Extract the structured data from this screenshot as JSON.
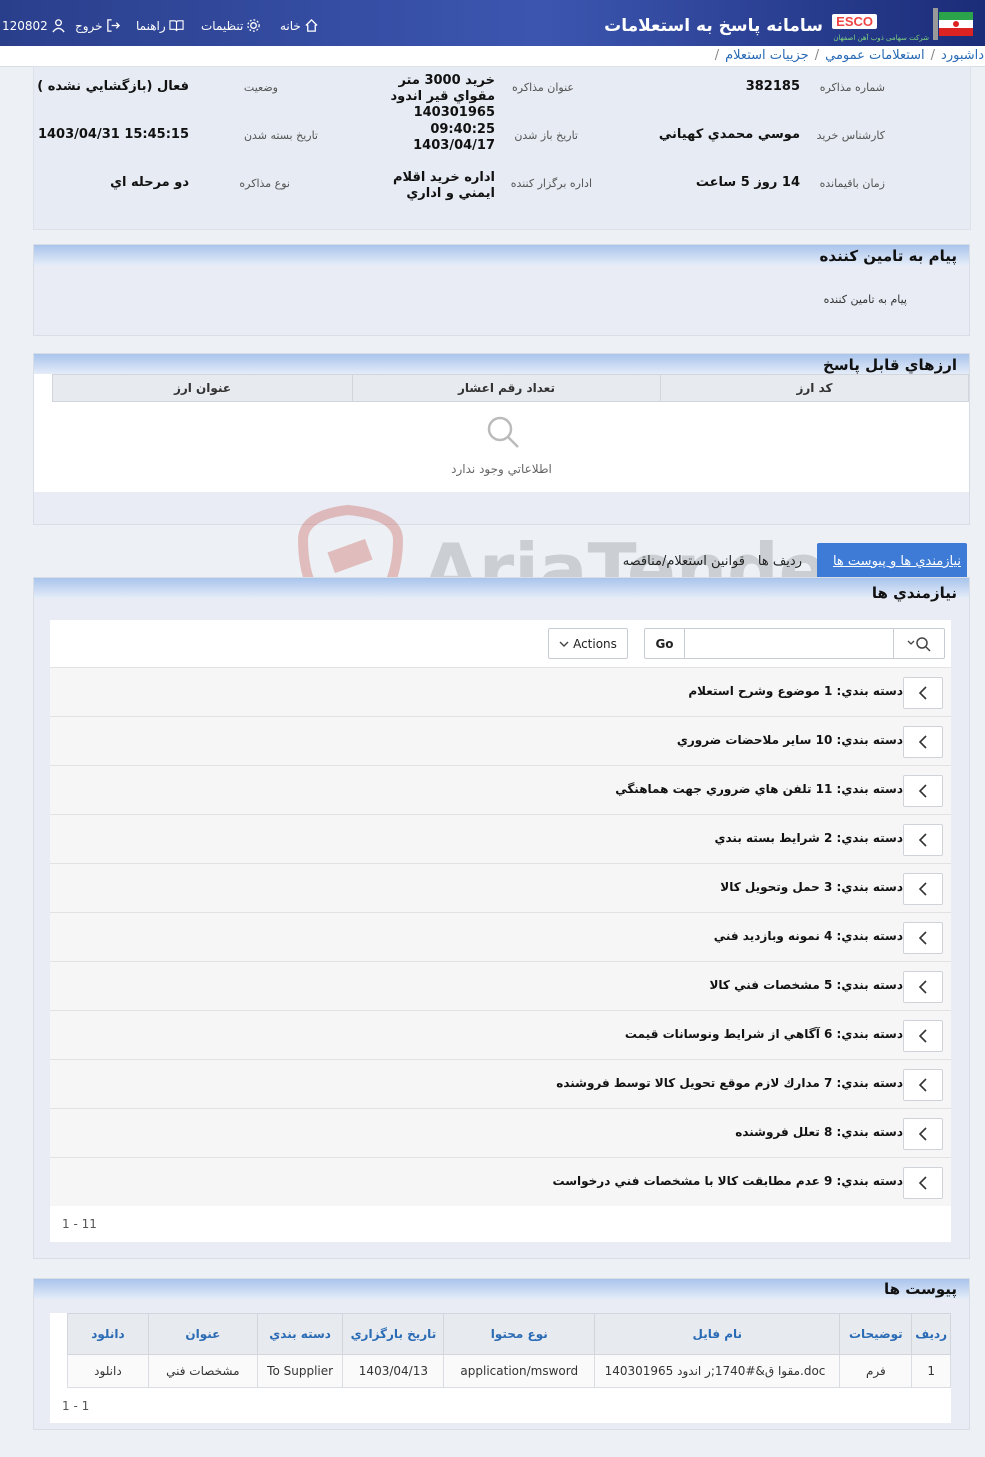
{
  "header": {
    "app_title": "سامانه پاسخ به استعلامات",
    "brand": "ESCO",
    "brand_subtitle": "شرکت سهامی ذوب آهن اصفهان",
    "nav": {
      "home": "خانه",
      "settings": "تنظیمات",
      "guide": "راهنما",
      "logout": "خروج",
      "user_id": "120802"
    }
  },
  "breadcrumb": {
    "items": [
      "ه داشبورد",
      "استعلامات عمومي",
      "جزييات استعلام"
    ]
  },
  "details": {
    "number_label": "شماره مذاکره",
    "number_value": "382185",
    "title_label": "عنوان مذاکره",
    "title_value": "خريد 3000 متر مقواي قير اندود 140301965",
    "status_label": "وضعيت",
    "status_value": "فعال (بازگشايي نشده )",
    "expert_label": "کارشناس خريد",
    "expert_value": "موسي محمدي کهياني",
    "open_label": "تاريخ باز شدن",
    "open_time": "09:40:25",
    "open_date": "1403/04/17",
    "close_label": "تاريخ بسته شدن",
    "close_value": "1403/04/31 15:45:15",
    "remaining_label": "زمان باقيمانده",
    "remaining_value": "14 روز 5 ساعت",
    "org_label": "اداره برگزار کننده",
    "org_value": "اداره خريد اقلام ايمني و اداري",
    "type_label": "نوع مذاکره",
    "type_value": "دو مرحله اي"
  },
  "supplier_message": {
    "title": "پيام به تامين کننده",
    "body": "پيام به تامين کننده"
  },
  "currencies": {
    "title": "ارزهاي قابل پاسخ",
    "columns": [
      "کد ارز",
      "تعداد رقم اعشار",
      "عنوان ارز"
    ],
    "empty_text": "اطلاعاتي وجود ندارد"
  },
  "tabs": [
    "نيازمندي ها و پيوست ها",
    "رديف ها",
    "قوانين استعلام/مناقصه"
  ],
  "requirements": {
    "title": "نيازمندي ها",
    "go_label": "Go",
    "actions_label": "Actions",
    "search_value": "",
    "items": [
      {
        "prefix": "دسته بندي:",
        "text": "1 موضوع وشرح استعلام"
      },
      {
        "prefix": "دسته بندي:",
        "text": "10 ساير ملاحضات ضروري"
      },
      {
        "prefix": "دسته بندي:",
        "text": "11 تلفن هاي ضروري جهت هماهنگي"
      },
      {
        "prefix": "دسته بندي:",
        "text": "2 شرايط بسته بندي"
      },
      {
        "prefix": "دسته بندي:",
        "text": "3 حمل وتحويل کالا"
      },
      {
        "prefix": "دسته بندي:",
        "text": "4 نمونه وبازديد فني"
      },
      {
        "prefix": "دسته بندي:",
        "text": "5 مشخصات فني کالا"
      },
      {
        "prefix": "دسته بندي:",
        "text": "6 آگاهي از شرايط ونوسانات قيمت"
      },
      {
        "prefix": "دسته بندي:",
        "text": "7 مدارك لازم موقع تحويل کالا توسط فروشنده"
      },
      {
        "prefix": "دسته بندي:",
        "text": "8 تعلل فروشنده"
      },
      {
        "prefix": "دسته بندي:",
        "text": "9 عدم مطابقت کالا با مشخصات فني درخواست"
      }
    ],
    "pagination": "1 - 11"
  },
  "attachments": {
    "title": "پيوست ها",
    "columns": [
      "رديف",
      "توضيحات",
      "نام فايل",
      "نوع محتوا",
      "تاريخ بارگزاري",
      "دسته بندي",
      "عنوان",
      "دانلود"
    ],
    "rows": [
      [
        "1",
        "فرم",
        "مقوا ق&#1740;ر اندود 140301965.doc",
        "application/msword",
        "1403/04/13",
        "To Supplier",
        "مشخصات فني",
        "دانلود"
      ]
    ],
    "pagination": "1 - 1"
  },
  "watermark": "AriaTender.net",
  "colors": {
    "header_blue": "#2a3f8c",
    "link_blue": "#2a6bb5",
    "region_head": "#a9c4ec",
    "watermark_red": "#c0392b"
  }
}
